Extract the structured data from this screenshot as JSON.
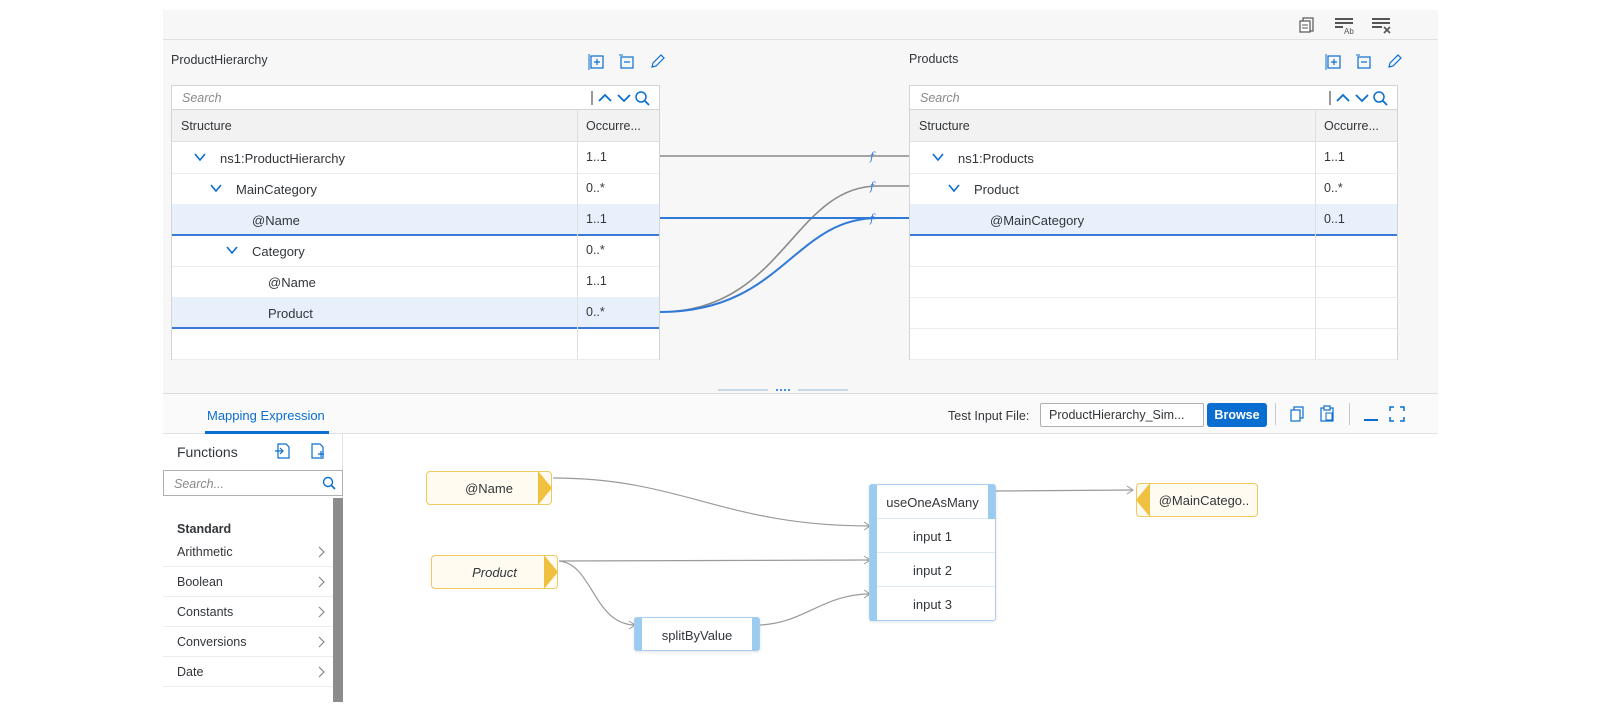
{
  "toolbar": {
    "icons": [
      "copy-mapping-icon",
      "rename-lines-icon",
      "clear-lines-icon"
    ]
  },
  "source": {
    "title": "ProductHierarchy",
    "search_placeholder": "Search",
    "col_structure": "Structure",
    "col_occurrence": "Occurre...",
    "rows": [
      {
        "label": "ns1:ProductHierarchy",
        "occ": "1..1"
      },
      {
        "label": "MainCategory",
        "occ": "0..*"
      },
      {
        "label": "@Name",
        "occ": "1..1"
      },
      {
        "label": "Category",
        "occ": "0..*"
      },
      {
        "label": "@Name",
        "occ": "1..1"
      },
      {
        "label": "Product",
        "occ": "0..*"
      }
    ]
  },
  "target": {
    "title": "Products",
    "search_placeholder": "Search",
    "col_structure": "Structure",
    "col_occurrence": "Occurre...",
    "rows": [
      {
        "label": "ns1:Products",
        "occ": "1..1"
      },
      {
        "label": "Product",
        "occ": "0..*"
      },
      {
        "label": "@MainCategory",
        "occ": "0..1"
      }
    ]
  },
  "expression": {
    "tab_label": "Mapping Expression",
    "test_input_label": "Test Input File:",
    "test_input_value": "ProductHierarchy_Sim...",
    "browse_label": "Browse"
  },
  "functions": {
    "title": "Functions",
    "search_placeholder": "Search...",
    "group": "Standard",
    "items": [
      "Arithmetic",
      "Boolean",
      "Constants",
      "Conversions",
      "Date"
    ]
  },
  "canvas": {
    "source_nodes": [
      "@Name",
      "Product"
    ],
    "function_node": {
      "name": "useOneAsMany",
      "ports": [
        "input 1",
        "input 2",
        "input 3"
      ]
    },
    "split_node": "splitByValue",
    "target_node": "@MainCatego.."
  },
  "colors": {
    "accent": "#0a6ed1",
    "selected_row": "#e8f1fb",
    "node_border": "#f0c860",
    "func_bar": "#9ccbf0"
  }
}
